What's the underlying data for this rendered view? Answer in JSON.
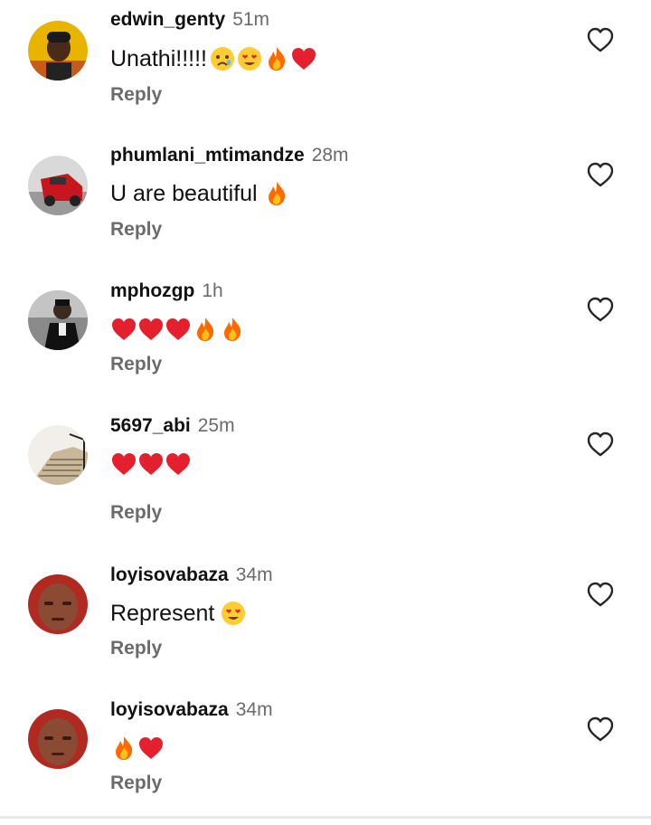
{
  "colors": {
    "username": "#111111",
    "meta": "#6b6b6b",
    "heart_outline": "#262626",
    "emoji_heart": "#e5202e",
    "emoji_fire": "#ff6a00",
    "emoji_face": "#ffcc33"
  },
  "reply_label": "Reply",
  "comments": [
    {
      "username": "edwin_genty",
      "time": "51m",
      "text": "Unathi!!!!!",
      "emojis": [
        "crying-face-emoji",
        "heart-eyes-emoji",
        "fire-emoji",
        "red-heart-emoji"
      ]
    },
    {
      "username": "phumlani_mtimandze",
      "time": "28m",
      "text": "U are beautiful",
      "emojis": [
        "fire-emoji"
      ]
    },
    {
      "username": "mphozgp",
      "time": "1h",
      "text": "",
      "emojis": [
        "red-heart-emoji",
        "red-heart-emoji",
        "red-heart-emoji",
        "fire-emoji",
        "fire-emoji"
      ]
    },
    {
      "username": "5697_abi",
      "time": "25m",
      "text": "",
      "emojis": [
        "red-heart-emoji",
        "red-heart-emoji",
        "red-heart-emoji"
      ]
    },
    {
      "username": "loyisovabaza",
      "time": "34m",
      "text": "Represent",
      "emojis": [
        "heart-eyes-emoji"
      ]
    },
    {
      "username": "loyisovabaza",
      "time": "34m",
      "text": "",
      "emojis": [
        "fire-emoji",
        "red-heart-emoji"
      ]
    }
  ]
}
